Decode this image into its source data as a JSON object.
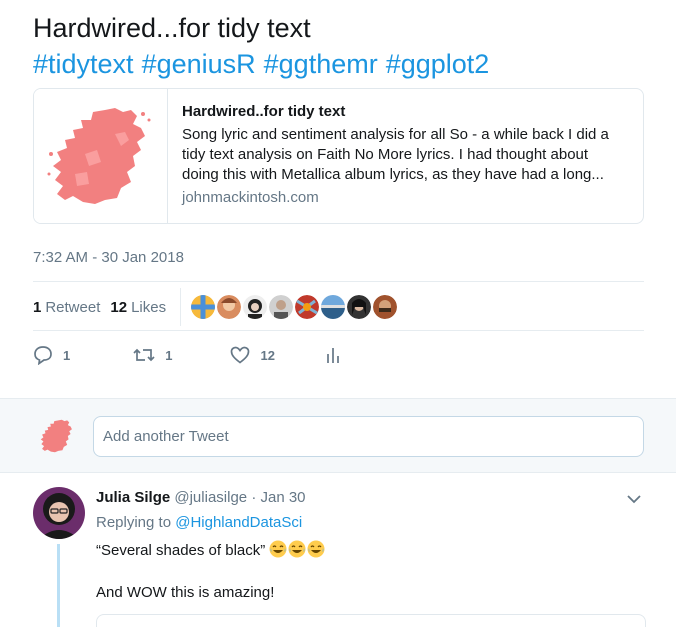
{
  "tweet": {
    "title": "Hardwired...for tidy text",
    "hashtags": [
      "#tidytext",
      "#geniusR",
      "#ggthemr",
      "#ggplot2"
    ]
  },
  "card": {
    "title": "Hardwired..for tidy text",
    "description": "Song lyric and sentiment analysis for all So - a while back I did a tidy text analysis on Faith No More lyrics. I had thought about doing this with Metallica album lyrics, as they have had a long...",
    "domain": "johnmackintosh.com",
    "thumb_icon": "scotland-map-icon",
    "thumb_color": "#f28080"
  },
  "timestamp": "7:32 AM - 30 Jan 2018",
  "stats": {
    "retweets_count": "1",
    "retweets_label": "Retweet",
    "likes_count": "12",
    "likes_label": "Likes"
  },
  "actions": {
    "reply_count": "1",
    "retweet_count": "1",
    "like_count": "12"
  },
  "reply_box": {
    "placeholder": "Add another Tweet"
  },
  "reply": {
    "name": "Julia Silge",
    "handle": "@juliasilge",
    "dot": "·",
    "date": "Jan 30",
    "replying_prefix": "Replying to",
    "replying_to": "@HighlandDataSci",
    "text": "“Several shades of black”",
    "emoji": "face-with-tears-of-joy",
    "text2": "And WOW this is amazing!"
  },
  "colors": {
    "link": "#1b95e0",
    "muted": "#657786",
    "thread_line": "#b9dff5",
    "like_heart": "#657786"
  }
}
